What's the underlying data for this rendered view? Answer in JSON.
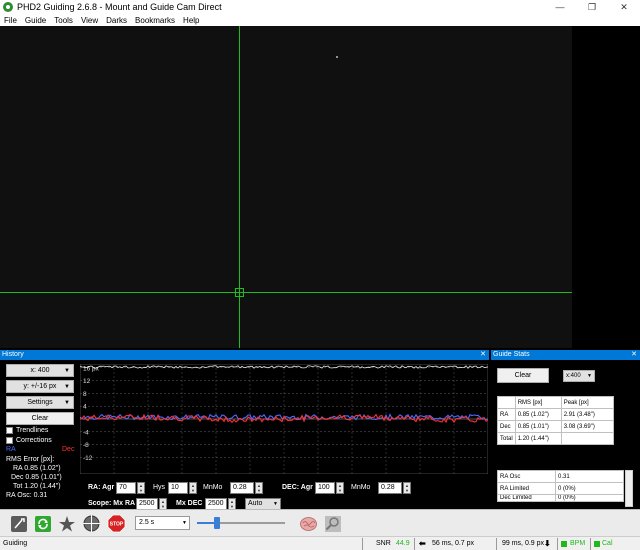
{
  "window": {
    "title": "PHD2 Guiding 2.6.8 - Mount and Guide Cam Direct",
    "minimize": "—",
    "maximize": "❐",
    "close": "✕"
  },
  "menu": [
    "File",
    "Guide",
    "Tools",
    "View",
    "Darks",
    "Bookmarks",
    "Help"
  ],
  "history": {
    "title": "History",
    "close": "✕",
    "x_scale": "x: 400",
    "y_scale": "y: +/-16 px",
    "settings": "Settings",
    "clear": "Clear",
    "trendlines": "Trendlines",
    "corrections": "Corrections",
    "legend_ra": "RA",
    "legend_dec": "Dec",
    "rms_error": "RMS Error [px]:",
    "rms_ra": "RA  0.85 (1.02\")",
    "rms_dec": "Dec  0.85 (1.01\")",
    "rms_tot": "Tot  1.20 (1.44\")",
    "ra_osc": "RA Osc: 0.31",
    "y_ticks": [
      "16 px",
      "12",
      "8",
      "4",
      "",
      "-4",
      "-8",
      "-12"
    ],
    "ra_agr_label": "RA: Agr",
    "ra_agr": "70",
    "hys_label": "Hys",
    "hys": "10",
    "mnmo_label": "MnMo",
    "ra_mnmo": "0.28",
    "dec_agr_label": "DEC: Agr",
    "dec_agr": "100",
    "dec_mnmo": "0.28",
    "scope_label": "Scope: Mx RA",
    "mx_ra": "2500",
    "mx_dec_label": "Mx DEC",
    "mx_dec": "2500",
    "mode": "Auto"
  },
  "guide_stats": {
    "title": "Guide Stats",
    "close": "✕",
    "clear": "Clear",
    "x_scale": "x:400",
    "headers": [
      "",
      "RMS [px]",
      "Peak [px]"
    ],
    "rows": [
      [
        "RA",
        "0.85 (1.02\")",
        "2.91 (3.48\")"
      ],
      [
        "Dec",
        "0.85 (1.01\")",
        "3.08 (3.69\")"
      ],
      [
        "Total",
        "1.20 (1.44\")",
        ""
      ]
    ],
    "rows2": [
      [
        "RA Osc",
        "0.31"
      ],
      [
        "RA Limited",
        "0 (0%)"
      ],
      [
        "Dec Limited",
        "0 (0%)"
      ]
    ]
  },
  "toolbar": {
    "exposure": "2.5 s"
  },
  "status": {
    "left": "Guiding",
    "snr_label": "SNR",
    "snr": "44.9",
    "ra_pulse": "56 ms, 0.7 px",
    "dec_pulse": "99 ms, 0.9 px",
    "bpm": "BPM",
    "cal": "Cal"
  },
  "colors": {
    "accent": "#0078d7",
    "ra": "#4a6cff",
    "dec": "#ff3030",
    "crosshair": "#1dbd1d"
  }
}
